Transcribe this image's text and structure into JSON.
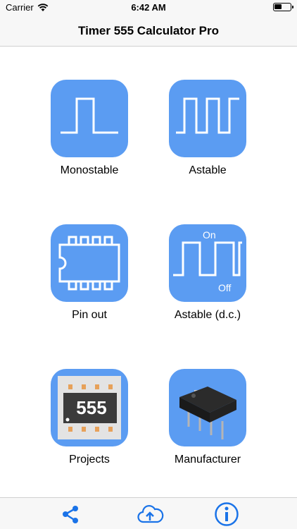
{
  "status_bar": {
    "carrier": "Carrier",
    "time": "6:42 AM"
  },
  "nav": {
    "title": "Timer 555 Calculator Pro"
  },
  "tiles": [
    {
      "label": "Monostable",
      "icon": "monostable-pulse-icon"
    },
    {
      "label": "Astable",
      "icon": "astable-square-wave-icon"
    },
    {
      "label": "Pin out",
      "icon": "ic-pinout-icon"
    },
    {
      "label": "Astable (d.c.)",
      "icon": "duty-cycle-wave-icon",
      "on_text": "On",
      "off_text": "Off"
    },
    {
      "label": "Projects",
      "icon": "chip-555-icon",
      "chip_text": "555"
    },
    {
      "label": "Manufacturer",
      "icon": "dip-package-icon"
    }
  ],
  "tab_bar": {
    "items": [
      {
        "icon": "share-icon"
      },
      {
        "icon": "cloud-upload-icon"
      },
      {
        "icon": "info-icon"
      }
    ]
  },
  "colors": {
    "accent": "#1a73e8",
    "tile_blue": "#5b9cf2"
  }
}
